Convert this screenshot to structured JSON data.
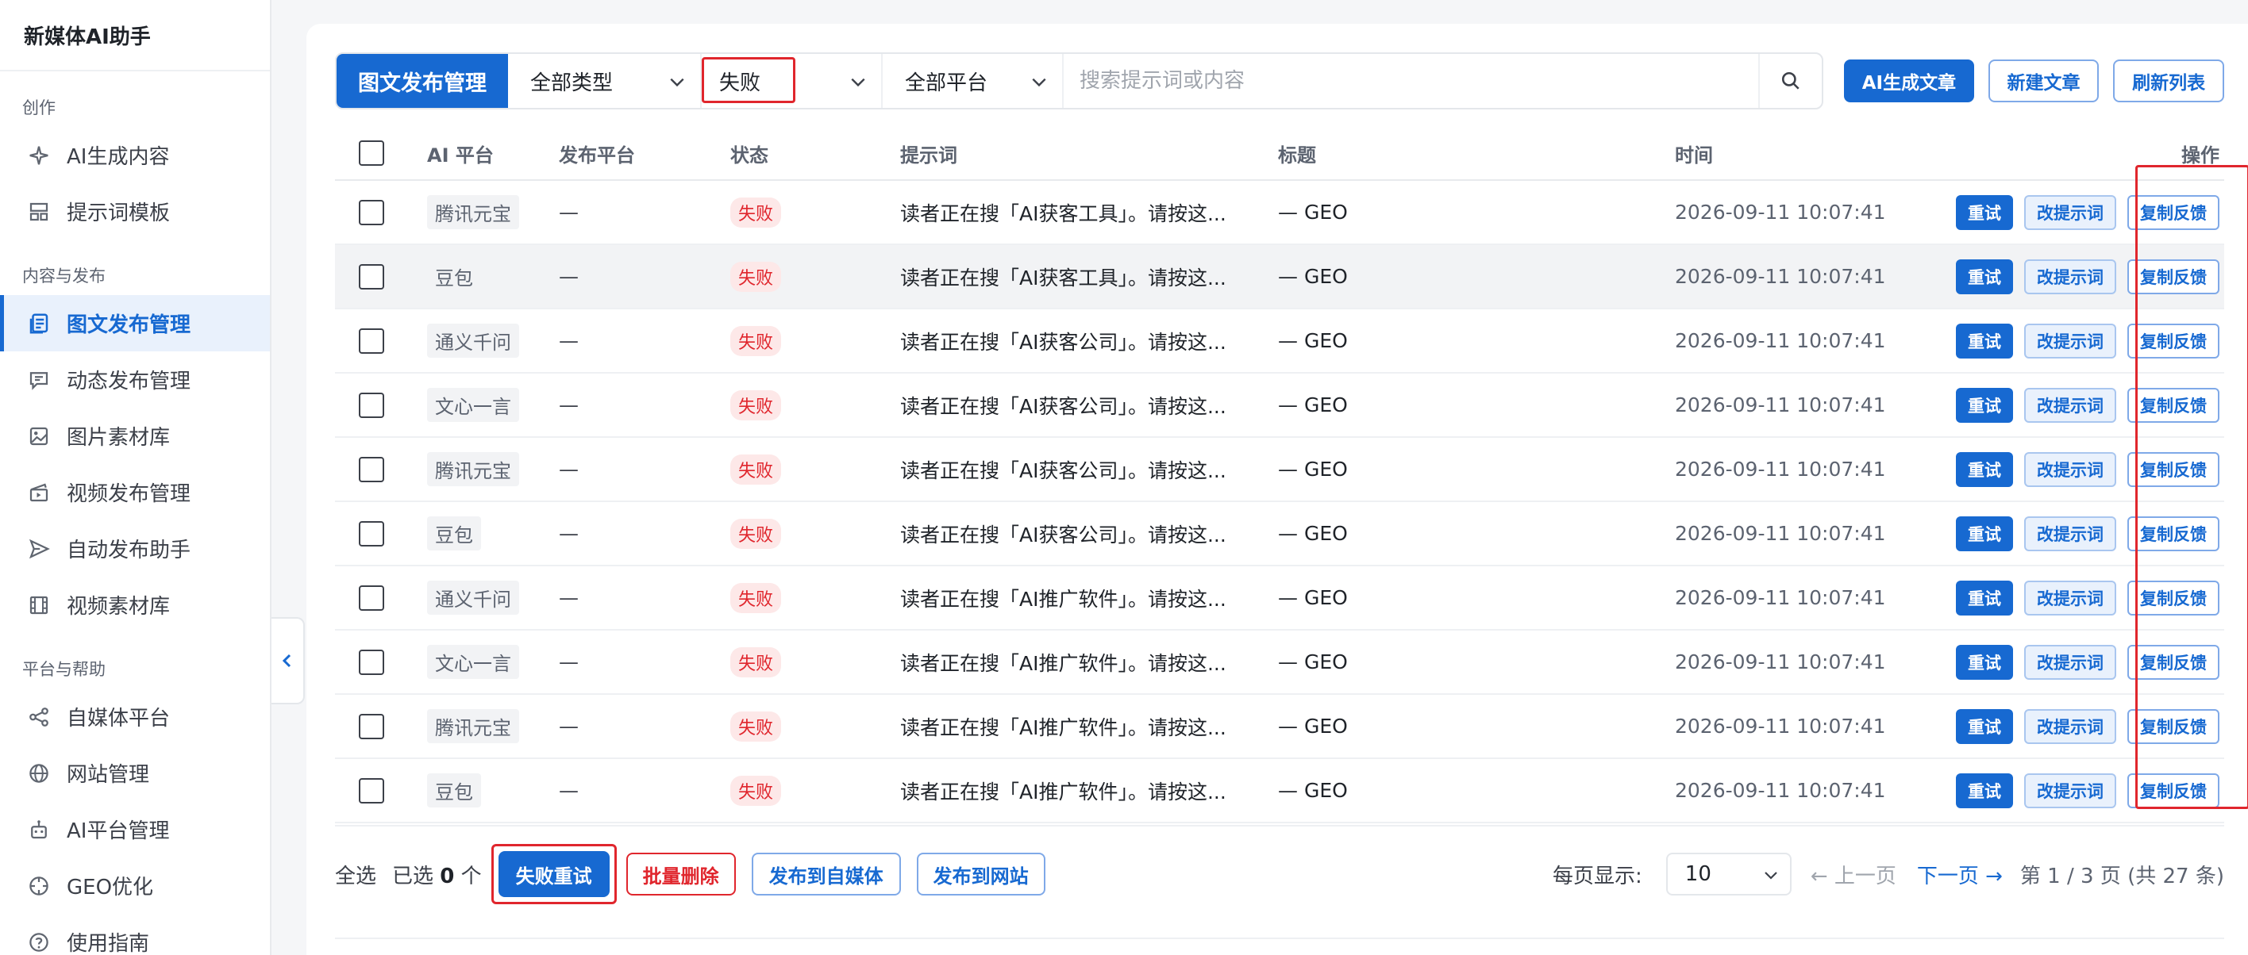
{
  "app": {
    "title": "新媒体AI助手"
  },
  "sidebar": {
    "sections": [
      {
        "title": "创作",
        "items": [
          {
            "label": "AI生成内容",
            "icon": "sparkle-icon"
          },
          {
            "label": "提示词模板",
            "icon": "template-icon"
          }
        ]
      },
      {
        "title": "内容与发布",
        "items": [
          {
            "label": "图文发布管理",
            "icon": "article-icon",
            "active": true
          },
          {
            "label": "动态发布管理",
            "icon": "message-icon"
          },
          {
            "label": "图片素材库",
            "icon": "image-icon"
          },
          {
            "label": "视频发布管理",
            "icon": "video-icon"
          },
          {
            "label": "自动发布助手",
            "icon": "send-icon"
          },
          {
            "label": "视频素材库",
            "icon": "film-icon"
          }
        ]
      },
      {
        "title": "平台与帮助",
        "items": [
          {
            "label": "自媒体平台",
            "icon": "share-icon"
          },
          {
            "label": "网站管理",
            "icon": "globe-icon"
          },
          {
            "label": "AI平台管理",
            "icon": "robot-icon"
          },
          {
            "label": "GEO优化",
            "icon": "target-icon"
          },
          {
            "label": "使用指南",
            "icon": "help-icon"
          }
        ]
      }
    ]
  },
  "toolbar": {
    "tab_title": "图文发布管理",
    "type_filter": "全部类型",
    "status_filter": "失败",
    "platform_filter": "全部平台",
    "search_placeholder": "搜索提示词或内容",
    "ai_generate": "AI生成文章",
    "new_article": "新建文章",
    "refresh": "刷新列表"
  },
  "table": {
    "headers": {
      "ai": "AI 平台",
      "publish": "发布平台",
      "status": "状态",
      "prompt": "提示词",
      "title": "标题",
      "time": "时间",
      "ops": "操作"
    },
    "op_labels": {
      "retry": "重试",
      "edit": "改提示词",
      "copy": "复制反馈"
    },
    "rows": [
      {
        "ai": "腾讯元宝",
        "publish": "—",
        "status": "失败",
        "prompt": "读者正在搜「AI获客工具」。请按这...",
        "title": "— GEO",
        "time": "2026-09-11 10:07:41"
      },
      {
        "ai": "豆包",
        "publish": "—",
        "status": "失败",
        "prompt": "读者正在搜「AI获客工具」。请按这...",
        "title": "— GEO",
        "time": "2026-09-11 10:07:41"
      },
      {
        "ai": "通义千问",
        "publish": "—",
        "status": "失败",
        "prompt": "读者正在搜「AI获客公司」。请按这...",
        "title": "— GEO",
        "time": "2026-09-11 10:07:41"
      },
      {
        "ai": "文心一言",
        "publish": "—",
        "status": "失败",
        "prompt": "读者正在搜「AI获客公司」。请按这...",
        "title": "— GEO",
        "time": "2026-09-11 10:07:41"
      },
      {
        "ai": "腾讯元宝",
        "publish": "—",
        "status": "失败",
        "prompt": "读者正在搜「AI获客公司」。请按这...",
        "title": "— GEO",
        "time": "2026-09-11 10:07:41"
      },
      {
        "ai": "豆包",
        "publish": "—",
        "status": "失败",
        "prompt": "读者正在搜「AI获客公司」。请按这...",
        "title": "— GEO",
        "time": "2026-09-11 10:07:41"
      },
      {
        "ai": "通义千问",
        "publish": "—",
        "status": "失败",
        "prompt": "读者正在搜「AI推广软件」。请按这...",
        "title": "— GEO",
        "time": "2026-09-11 10:07:41"
      },
      {
        "ai": "文心一言",
        "publish": "—",
        "status": "失败",
        "prompt": "读者正在搜「AI推广软件」。请按这...",
        "title": "— GEO",
        "time": "2026-09-11 10:07:41"
      },
      {
        "ai": "腾讯元宝",
        "publish": "—",
        "status": "失败",
        "prompt": "读者正在搜「AI推广软件」。请按这...",
        "title": "— GEO",
        "time": "2026-09-11 10:07:41"
      },
      {
        "ai": "豆包",
        "publish": "—",
        "status": "失败",
        "prompt": "读者正在搜「AI推广软件」。请按这...",
        "title": "— GEO",
        "time": "2026-09-11 10:07:41"
      }
    ]
  },
  "footer": {
    "select_all": "全选",
    "selected_prefix": "已选",
    "selected_count": "0",
    "selected_suffix": "个",
    "retry_failed": "失败重试",
    "batch_delete": "批量删除",
    "publish_media": "发布到自媒体",
    "publish_site": "发布到网站",
    "per_page_label": "每页显示:",
    "per_page_value": "10",
    "prev": "← 上一页",
    "next": "下一页 →",
    "page_info": "第 1 / 3 页 (共 27 条)"
  },
  "colors": {
    "accent": "#1769d1",
    "danger": "#e0262d",
    "highlight_box": "#e0262d"
  }
}
